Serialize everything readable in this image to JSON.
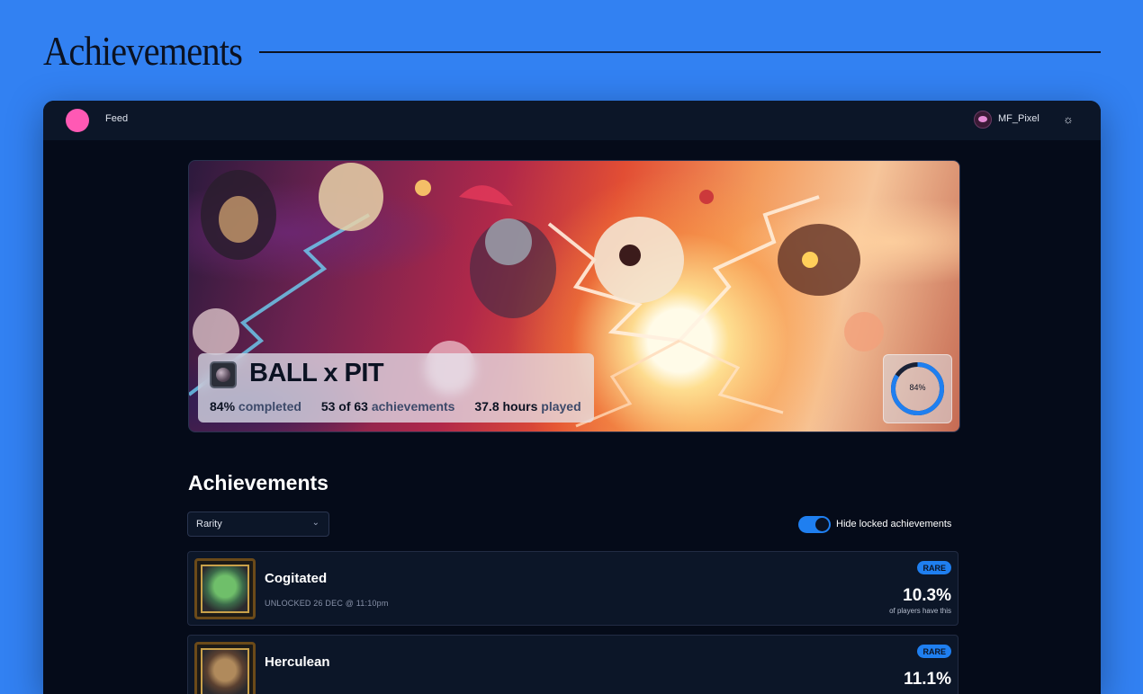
{
  "page": {
    "heading": "Achievements"
  },
  "topbar": {
    "nav_feed": "Feed",
    "username": "MF_Pixel",
    "logo_color": "#ff59b4",
    "theme_icon": "sun-icon"
  },
  "game": {
    "title": "BALL x PIT",
    "completed_value": "84%",
    "completed_label": "completed",
    "achievements_value": "53 of 63",
    "achievements_label": "achievements",
    "hours_value": "37.8 hours",
    "hours_label": "played",
    "progress_label": "84%",
    "progress_fraction": 0.84
  },
  "section": {
    "title": "Achievements",
    "sort_value": "Rarity",
    "toggle_label": "Hide locked achievements",
    "toggle_on": true
  },
  "achievements": [
    {
      "name": "Cogitated",
      "unlocked": "UNLOCKED 26 DEC @ 11:10pm",
      "rarity": "RARE",
      "percent": "10.3%",
      "percent_sub": "of players have this",
      "icon": "green-sage-portrait-icon"
    },
    {
      "name": "Herculean",
      "rarity": "RARE",
      "percent": "11.1%",
      "icon": "bearded-warrior-portrait-icon"
    }
  ],
  "colors": {
    "background": "#3281f2",
    "window": "#050b19",
    "card": "#0c1628",
    "accent": "#1f7ff0"
  }
}
